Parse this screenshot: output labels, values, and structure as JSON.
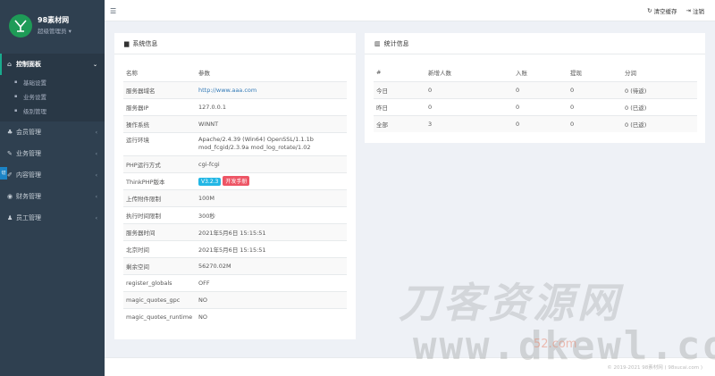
{
  "brand": {
    "logo_glyph": "YK",
    "name": "98素材网",
    "role": "超级管理员 ▾"
  },
  "sidebar": {
    "active_group": {
      "icon": "home-icon",
      "label": "控制面板"
    },
    "sub_items": [
      {
        "label": "基础设置"
      },
      {
        "label": "业务设置"
      },
      {
        "label": "级别管理"
      }
    ],
    "groups": [
      {
        "icon": "users-icon",
        "label": "会员管理"
      },
      {
        "icon": "pin-icon",
        "label": "业务管理"
      },
      {
        "icon": "edit-icon",
        "label": "内容管理"
      },
      {
        "icon": "finance-icon",
        "label": "财务管理"
      },
      {
        "icon": "user-icon",
        "label": "员工管理"
      }
    ],
    "side_tab": "切"
  },
  "topbar": {
    "clear_cache": "清空缓存",
    "logout": "注销"
  },
  "system_panel": {
    "title": "系统信息",
    "header": [
      "名称",
      "参数"
    ],
    "rows": [
      {
        "name": "服务器域名",
        "value": "http://www.aaa.com"
      },
      {
        "name": "服务器IP",
        "value": "127.0.0.1"
      },
      {
        "name": "操作系统",
        "value": "WINNT"
      },
      {
        "name": "运行环境",
        "value": "Apache/2.4.39 (Win64) OpenSSL/1.1.1b",
        "value2": "mod_fcgid/2.3.9a mod_log_rotate/1.02"
      },
      {
        "name": "PHP运行方式",
        "value": "cgi-fcgi"
      },
      {
        "name": "ThinkPHP版本",
        "badge_version": "V3.2.3",
        "badge_manual": "开发手册"
      },
      {
        "name": "上传附件限制",
        "value": "100M"
      },
      {
        "name": "执行时间限制",
        "value": "300秒"
      },
      {
        "name": "服务器时间",
        "value": "2021年5月6日 15:15:51"
      },
      {
        "name": "北京时间",
        "value": "2021年5月6日 15:15:51"
      },
      {
        "name": "剩余空间",
        "value": "56270.02M"
      },
      {
        "name": "register_globals",
        "value": "OFF"
      },
      {
        "name": "magic_quotes_gpc",
        "value": "NO"
      },
      {
        "name": "magic_quotes_runtime",
        "value": "NO"
      }
    ]
  },
  "stats_panel": {
    "title": "统计信息",
    "header": [
      "#",
      "新增人数",
      "入账",
      "提现",
      "分润"
    ],
    "rows": [
      [
        "今日",
        "0",
        "0",
        "0",
        "0 (待返)"
      ],
      [
        "昨日",
        "0",
        "0",
        "0",
        "0 (已返)"
      ],
      [
        "全部",
        "3",
        "0",
        "0",
        "0 (已返)"
      ]
    ]
  },
  "footer": {
    "text": "© 2019-2021 98素材网 ( 98sucai.com )"
  },
  "watermark": {
    "line1": "刀客资源网",
    "line2": "www.dkewl.com",
    "line3": "52",
    "line3_suffix": "com"
  },
  "colors": {
    "sidebar": "#2f4050",
    "accent": "#19aa8d",
    "link": "#337ab7",
    "badge_blue": "#23b7e5",
    "badge_red": "#ed5565",
    "logo": "#1e9b57"
  }
}
